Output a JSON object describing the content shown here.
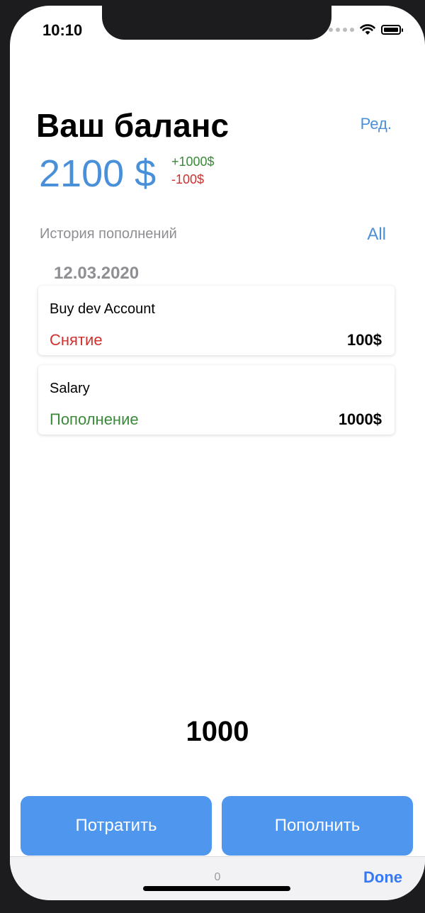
{
  "status_bar": {
    "time": "10:10"
  },
  "header": {
    "title": "Ваш баланс",
    "edit_label": "Ред."
  },
  "balance": {
    "amount": "2100 $",
    "plus": "+1000$",
    "minus": "-100$"
  },
  "history": {
    "label": "История пополнений",
    "all_label": "All",
    "date": "12.03.2020",
    "items": [
      {
        "name": "Buy dev Account",
        "kind": "Снятие",
        "amount": "100$"
      },
      {
        "name": "Salary",
        "kind": "Пополнение",
        "amount": "1000$"
      }
    ]
  },
  "input": {
    "value": "1000"
  },
  "actions": {
    "spend_label": "Потратить",
    "topup_label": "Пополнить"
  },
  "keyboard": {
    "center_text": "0",
    "done_label": "Done"
  },
  "colors": {
    "accent": "#4a90d9",
    "button": "#4f96ef",
    "withdraw": "#d0312d",
    "deposit": "#3a8a3a"
  }
}
